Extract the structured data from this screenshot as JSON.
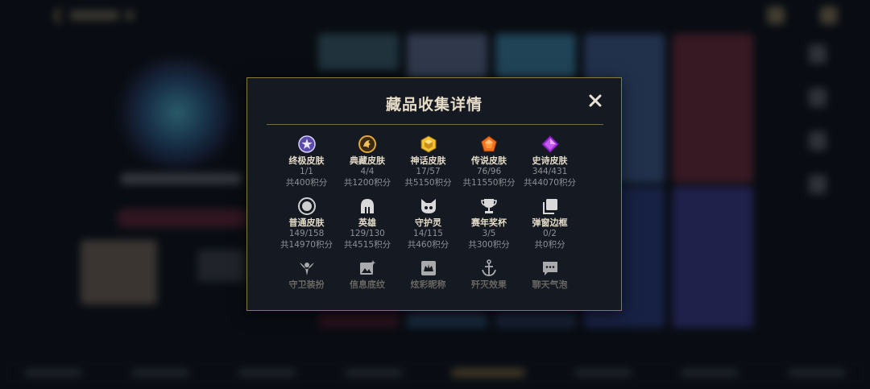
{
  "background": {
    "accent_color": "#c8aa6e"
  },
  "modal": {
    "title": "藏品收集详情",
    "close_icon": "close-icon",
    "border_color": "#8f7742",
    "rows": [
      [
        {
          "label": "终极皮肤",
          "count": "1/1",
          "points": "共400积分",
          "icon": "ultimate-skin-icon",
          "color": "#b9a7ff"
        },
        {
          "label": "典藏皮肤",
          "count": "4/4",
          "points": "共1200积分",
          "icon": "collection-skin-icon",
          "color": "#e2a83a"
        },
        {
          "label": "神话皮肤",
          "count": "17/57",
          "points": "共5150积分",
          "icon": "mythic-skin-icon",
          "color": "#f2c230"
        },
        {
          "label": "传说皮肤",
          "count": "76/96",
          "points": "共11550积分",
          "icon": "legendary-skin-icon",
          "color": "#f0701e"
        },
        {
          "label": "史诗皮肤",
          "count": "344/431",
          "points": "共44070积分",
          "icon": "epic-skin-icon",
          "color": "#b44fe0"
        }
      ],
      [
        {
          "label": "普通皮肤",
          "count": "149/158",
          "points": "共14970积分",
          "icon": "normal-skin-icon",
          "color": "#c9c9c9"
        },
        {
          "label": "英雄",
          "count": "129/130",
          "points": "共4515积分",
          "icon": "champion-helmet-icon",
          "color": "#d9d9d9"
        },
        {
          "label": "守护灵",
          "count": "14/115",
          "points": "共460积分",
          "icon": "guardian-icon",
          "color": "#d9d9d9"
        },
        {
          "label": "赛年奖杯",
          "count": "3/5",
          "points": "共300积分",
          "icon": "trophy-icon",
          "color": "#d9d9d9"
        },
        {
          "label": "弹窗边框",
          "count": "0/2",
          "points": "共0积分",
          "icon": "popup-frame-icon",
          "color": "#d9d9d9"
        }
      ],
      [
        {
          "label": "守卫装扮",
          "icon": "ward-skin-icon"
        },
        {
          "label": "信息底纹",
          "icon": "info-pattern-icon"
        },
        {
          "label": "炫彩昵称",
          "icon": "chroma-nickname-icon"
        },
        {
          "label": "歼灭效果",
          "icon": "annihilation-effect-icon"
        },
        {
          "label": "聊天气泡",
          "icon": "chat-bubble-icon"
        }
      ]
    ]
  }
}
